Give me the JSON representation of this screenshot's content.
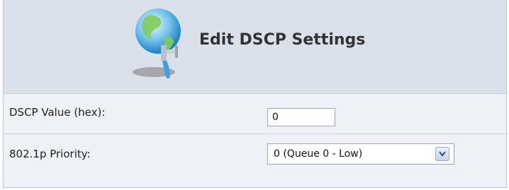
{
  "header": {
    "title": "Edit DSCP Settings",
    "icon": "globe-tap-icon"
  },
  "fields": {
    "dscp_value": {
      "label": "DSCP Value (hex):",
      "value": "0"
    },
    "priority": {
      "label": "802.1p Priority:",
      "selected": "0 (Queue 0 - Low)"
    }
  },
  "colors": {
    "header_bg": "#dbe1ea",
    "row_bg": "#eef1f5",
    "border": "#b9c6d9"
  }
}
